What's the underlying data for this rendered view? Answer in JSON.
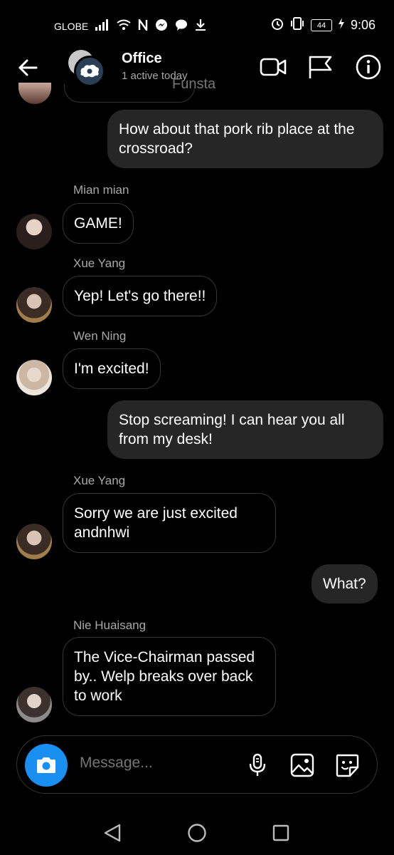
{
  "status_bar": {
    "carrier": "GLOBE",
    "battery": "44",
    "time": "9:06",
    "icons": [
      "signal-icon",
      "wifi-icon",
      "nfc-icon",
      "messenger-icon",
      "chat-icon",
      "download-icon",
      "alarm-icon",
      "vibrate-icon",
      "charging-icon"
    ]
  },
  "header": {
    "title": "Office",
    "subtitle": "1 active today",
    "watermark": "Funsta"
  },
  "messages": [
    {
      "type": "outgoing",
      "text": "How about that pork rib place at the crossroad?"
    },
    {
      "type": "incoming",
      "sender": "Mian mian",
      "text": "GAME!"
    },
    {
      "type": "incoming",
      "sender": "Xue Yang",
      "text": "Yep! Let's go there!!"
    },
    {
      "type": "incoming",
      "sender": "Wen Ning",
      "text": "I'm excited!"
    },
    {
      "type": "outgoing",
      "text": "Stop screaming! I can hear you all from my desk!"
    },
    {
      "type": "incoming",
      "sender": "Xue Yang",
      "text": "Sorry we are just excited andnhwi"
    },
    {
      "type": "outgoing",
      "text": "What?"
    },
    {
      "type": "incoming",
      "sender": "Nie Huaisang",
      "text": "The Vice-Chairman passed by.. Welp breaks over back to work"
    }
  ],
  "composer": {
    "placeholder": "Message..."
  },
  "colors": {
    "background": "#000000",
    "outgoing_bubble": "#262626",
    "camera_button": "#1a8ff2",
    "secondary_text": "#a8a8a8"
  }
}
